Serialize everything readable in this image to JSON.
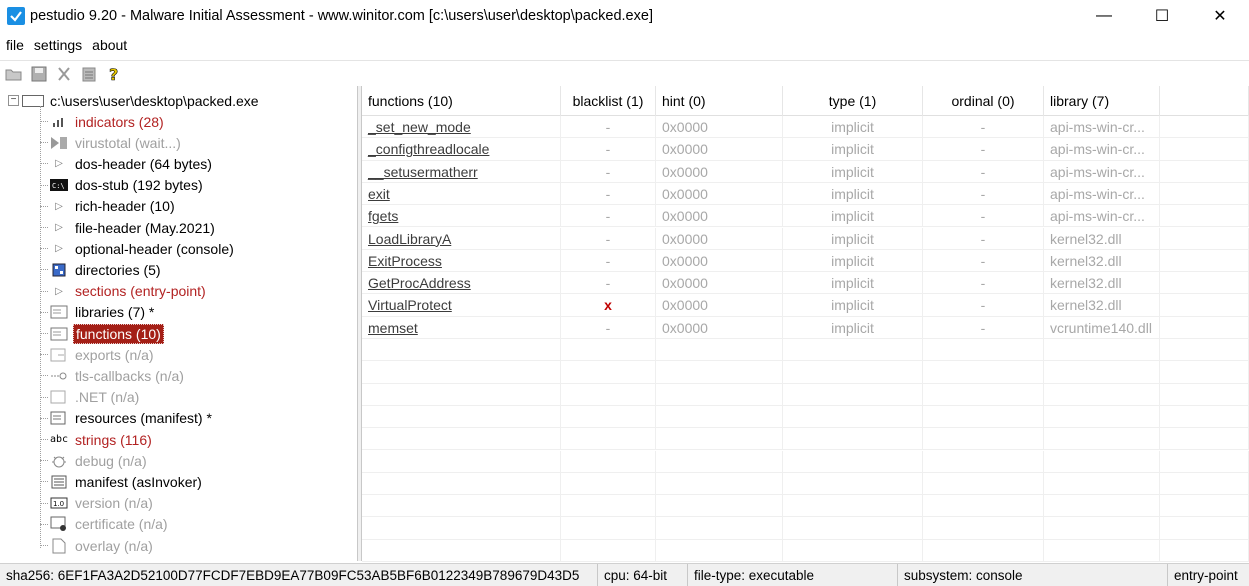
{
  "window": {
    "title": "pestudio 9.20 - Malware Initial Assessment - www.winitor.com [c:\\users\\user\\desktop\\packed.exe]",
    "controls": {
      "minimize": "—",
      "maximize": "☐",
      "close": "✕"
    }
  },
  "menu": {
    "file": "file",
    "settings": "settings",
    "about": "about"
  },
  "tree": {
    "root": "c:\\users\\user\\desktop\\packed.exe",
    "items": [
      {
        "label": "indicators (28)",
        "icon": "bar-chart-icon",
        "style": "red"
      },
      {
        "label": "virustotal (wait...)",
        "icon": "virustotal-icon",
        "style": "gray"
      },
      {
        "label": "dos-header (64 bytes)",
        "icon": "expand-arrow-icon",
        "style": "normal"
      },
      {
        "label": "dos-stub (192 bytes)",
        "icon": "console-icon",
        "style": "normal"
      },
      {
        "label": "rich-header (10)",
        "icon": "expand-arrow-icon",
        "style": "normal"
      },
      {
        "label": "file-header (May.2021)",
        "icon": "expand-arrow-icon",
        "style": "normal"
      },
      {
        "label": "optional-header (console)",
        "icon": "expand-arrow-icon",
        "style": "normal"
      },
      {
        "label": "directories (5)",
        "icon": "directories-icon",
        "style": "normal"
      },
      {
        "label": "sections (entry-point)",
        "icon": "expand-arrow-icon",
        "style": "red"
      },
      {
        "label": "libraries (7) *",
        "icon": "library-icon",
        "style": "normal"
      },
      {
        "label": "functions (10)",
        "icon": "function-icon",
        "style": "selected"
      },
      {
        "label": "exports (n/a)",
        "icon": "export-icon",
        "style": "gray"
      },
      {
        "label": "tls-callbacks (n/a)",
        "icon": "key-icon",
        "style": "gray"
      },
      {
        "label": ".NET (n/a)",
        "icon": "dotnet-icon",
        "style": "gray"
      },
      {
        "label": "resources (manifest) *",
        "icon": "resources-icon",
        "style": "normal"
      },
      {
        "label": "strings (116)",
        "icon": "abc-icon",
        "style": "red"
      },
      {
        "label": "debug (n/a)",
        "icon": "bug-icon",
        "style": "gray"
      },
      {
        "label": "manifest (asInvoker)",
        "icon": "manifest-icon",
        "style": "normal"
      },
      {
        "label": "version (n/a)",
        "icon": "version-icon",
        "style": "gray"
      },
      {
        "label": "certificate (n/a)",
        "icon": "certificate-icon",
        "style": "gray"
      },
      {
        "label": "overlay (n/a)",
        "icon": "overlay-icon",
        "style": "gray"
      }
    ]
  },
  "table": {
    "headers": [
      "functions (10)",
      "blacklist (1)",
      "hint (0)",
      "type (1)",
      "ordinal (0)",
      "library (7)"
    ],
    "rows": [
      [
        "_set_new_mode",
        "-",
        "0x0000",
        "implicit",
        "-",
        "api-ms-win-cr..."
      ],
      [
        "_configthreadlocale",
        "-",
        "0x0000",
        "implicit",
        "-",
        "api-ms-win-cr..."
      ],
      [
        "__setusermatherr",
        "-",
        "0x0000",
        "implicit",
        "-",
        "api-ms-win-cr..."
      ],
      [
        "exit",
        "-",
        "0x0000",
        "implicit",
        "-",
        "api-ms-win-cr..."
      ],
      [
        "fgets",
        "-",
        "0x0000",
        "implicit",
        "-",
        "api-ms-win-cr..."
      ],
      [
        "LoadLibraryA",
        "-",
        "0x0000",
        "implicit",
        "-",
        "kernel32.dll"
      ],
      [
        "ExitProcess",
        "-",
        "0x0000",
        "implicit",
        "-",
        "kernel32.dll"
      ],
      [
        "GetProcAddress",
        "-",
        "0x0000",
        "implicit",
        "-",
        "kernel32.dll"
      ],
      [
        "VirtualProtect",
        "x",
        "0x0000",
        "implicit",
        "-",
        "kernel32.dll"
      ],
      [
        "memset",
        "-",
        "0x0000",
        "implicit",
        "-",
        "vcruntime140.dll"
      ]
    ]
  },
  "status": {
    "sha256": "sha256: 6EF1FA3A2D52100D77FCDF7EBD9EA77B09FC53AB5BF6B0122349B789679D43D5",
    "cpu": "cpu: 64-bit",
    "filetype": "file-type: executable",
    "subsystem": "subsystem: console",
    "entry": "entry-point"
  }
}
